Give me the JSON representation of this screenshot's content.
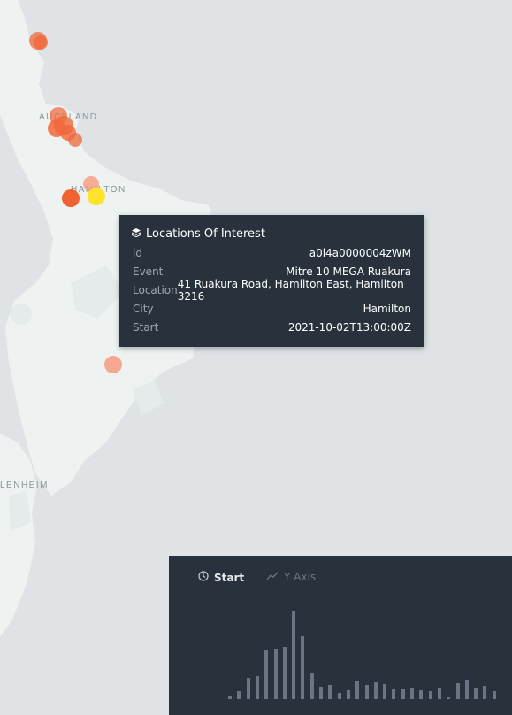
{
  "map": {
    "labels": [
      {
        "id": "auckland",
        "text": "AUCKLAND"
      },
      {
        "id": "hamilton",
        "text": "HAMILTON"
      },
      {
        "id": "blenheim",
        "text": "LENHEIM"
      }
    ],
    "colors": {
      "land": "#eef2f1",
      "sea": "#dfe3e6",
      "park": "#e5ebea",
      "poi_main": "#f0683b",
      "poi_light": "#f59577",
      "poi_selected": "#ffe32a"
    }
  },
  "tooltip": {
    "title": "Locations Of Interest",
    "icon": "layers-icon",
    "rows": [
      {
        "key": "id",
        "value": "a0l4a0000004zWM"
      },
      {
        "key": "Event",
        "value": "Mitre 10 MEGA Ruakura"
      },
      {
        "key": "Location",
        "value": "41 Ruakura Road, Hamilton East, Hamilton 3216"
      },
      {
        "key": "City",
        "value": "Hamilton"
      },
      {
        "key": "Start",
        "value": "2021-10-02T13:00:00Z"
      }
    ]
  },
  "timeline": {
    "tab_start": "Start",
    "tab_start_icon": "clock-icon",
    "tab_y": "Y Axis",
    "tab_y_icon": "line-chart-icon",
    "histogram": [
      3,
      9,
      24,
      27,
      57,
      58,
      60,
      102,
      72,
      31,
      14,
      16,
      7,
      10,
      20,
      16,
      19,
      17,
      11,
      11,
      12,
      10,
      9,
      12,
      2,
      18,
      22,
      12,
      15,
      9
    ]
  }
}
